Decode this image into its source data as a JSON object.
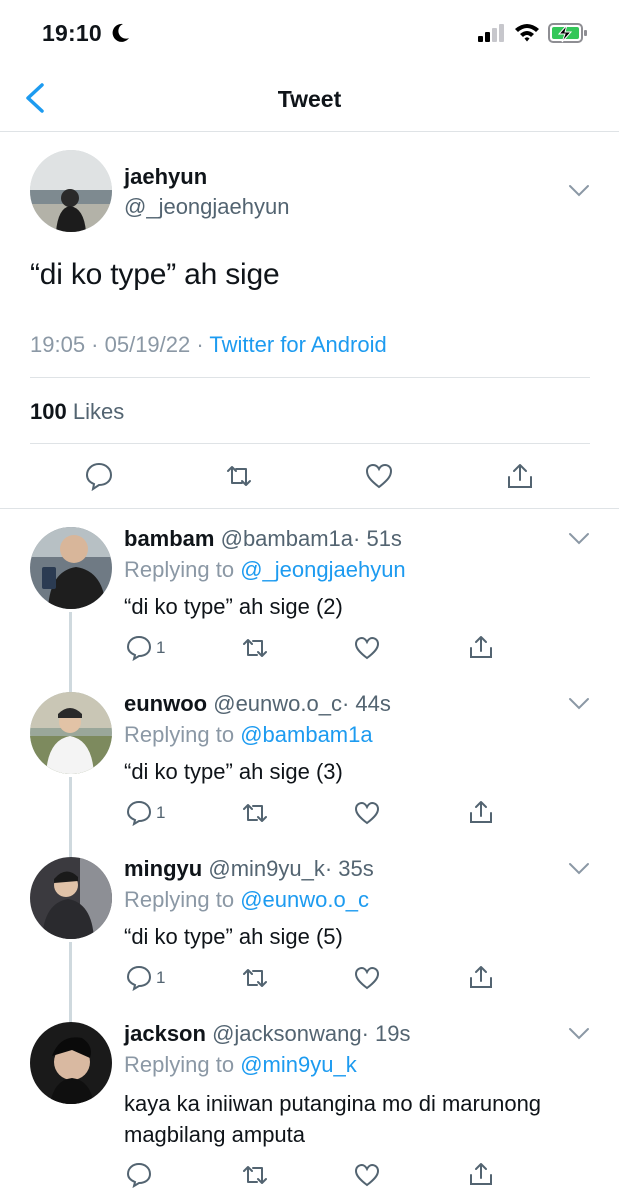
{
  "status": {
    "time": "19:10"
  },
  "nav": {
    "title": "Tweet"
  },
  "tweet": {
    "name": "jaehyun",
    "handle": "@_jeongjaehyun",
    "text": "“di ko type” ah sige",
    "time": "19:05 · 05/19/22 ·",
    "source": "Twitter for Android",
    "likes_count": "100",
    "likes_label": "Likes"
  },
  "replies": [
    {
      "name": "bambam",
      "handle": "@bambam1a",
      "age": "· 51s",
      "replying_label": "Replying to",
      "replying_to": "@_jeongjaehyun",
      "text": "“di ko type” ah sige (2)",
      "reply_count": "1"
    },
    {
      "name": "eunwoo",
      "handle": "@eunwo.o_c",
      "age": "· 44s",
      "replying_label": "Replying to",
      "replying_to": "@bambam1a",
      "text": "“di ko type” ah sige (3)",
      "reply_count": "1"
    },
    {
      "name": "mingyu",
      "handle": "@min9yu_k",
      "age": "· 35s",
      "replying_label": "Replying to",
      "replying_to": "@eunwo.o_c",
      "text": "“di ko type” ah sige (5)",
      "reply_count": "1"
    },
    {
      "name": "jackson",
      "handle": "@jacksonwang",
      "age": "· 19s",
      "replying_label": "Replying to",
      "replying_to": "@min9yu_k",
      "text": "kaya ka iniiwan putangina mo di marunong magbilang amputa",
      "reply_count": ""
    }
  ],
  "colors": {
    "accent": "#1d9bf0",
    "muted": "#536471",
    "divider": "#dfe3e6",
    "battery_fill": "#34c759"
  }
}
